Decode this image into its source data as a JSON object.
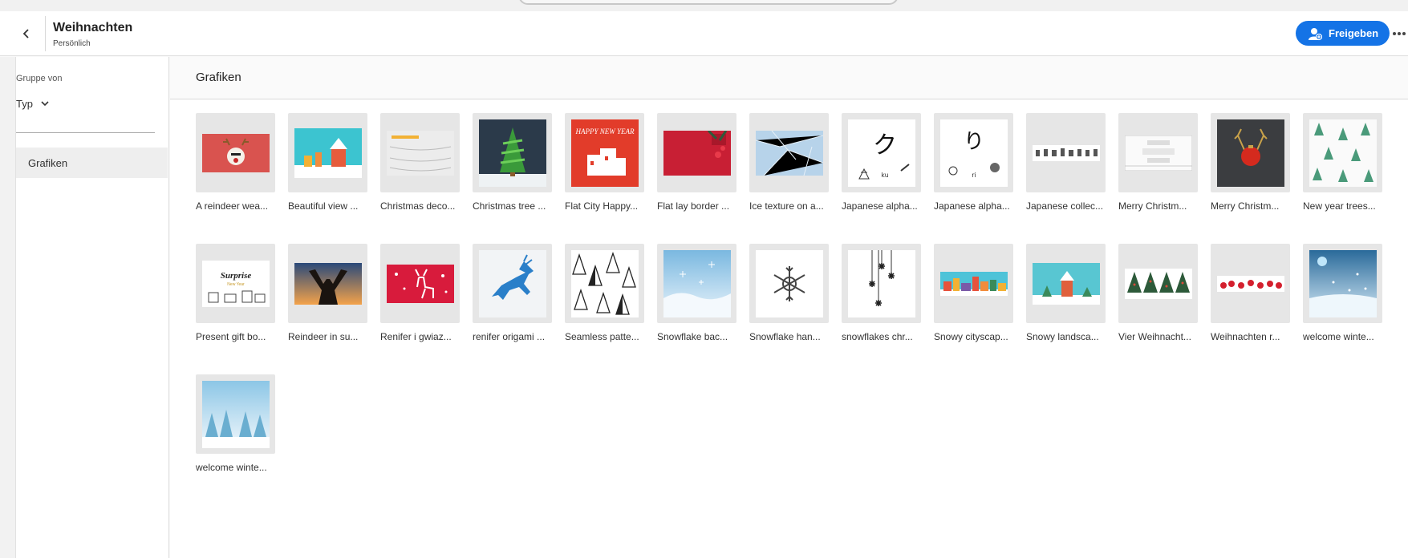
{
  "header": {
    "title": "Weihnachten",
    "subtitle": "Persönlich",
    "share_label": "Freigeben"
  },
  "sidebar": {
    "group_label": "Gruppe von",
    "type_select": "Typ",
    "items": [
      {
        "label": "Grafiken"
      }
    ]
  },
  "section": {
    "title": "Grafiken"
  },
  "assets": [
    {
      "label": "A reindeer wea..."
    },
    {
      "label": "Beautiful view ..."
    },
    {
      "label": "Christmas deco..."
    },
    {
      "label": "Christmas tree ..."
    },
    {
      "label": "Flat City Happy..."
    },
    {
      "label": "Flat lay border ..."
    },
    {
      "label": "Ice texture on a..."
    },
    {
      "label": "Japanese alpha..."
    },
    {
      "label": "Japanese alpha..."
    },
    {
      "label": "Japanese collec..."
    },
    {
      "label": "Merry Christm..."
    },
    {
      "label": "Merry Christm..."
    },
    {
      "label": "New year trees..."
    },
    {
      "label": "Present gift bo..."
    },
    {
      "label": "Reindeer in su..."
    },
    {
      "label": "Renifer i gwiaz..."
    },
    {
      "label": "renifer origami ..."
    },
    {
      "label": "Seamless patte..."
    },
    {
      "label": "Snowflake bac..."
    },
    {
      "label": "Snowflake han..."
    },
    {
      "label": "snowflakes chr..."
    },
    {
      "label": "Snowy cityscap..."
    },
    {
      "label": "Snowy landsca..."
    },
    {
      "label": "Vier Weihnacht..."
    },
    {
      "label": "Weihnachten r..."
    },
    {
      "label": "welcome winte..."
    },
    {
      "label": "welcome winte..."
    }
  ],
  "thumb_text": {
    "flat_city": "HAPPY NEW YEAR",
    "jp1_char": "ク",
    "jp1_sub": "ku",
    "jp2_char": "り",
    "jp2_sub": "ri",
    "present_title": "Surprise",
    "present_sub": "New Year"
  },
  "colors": {
    "accent": "#1473e6",
    "text": "#2c2c2c",
    "thumb_bg": "#e6e6e6"
  }
}
